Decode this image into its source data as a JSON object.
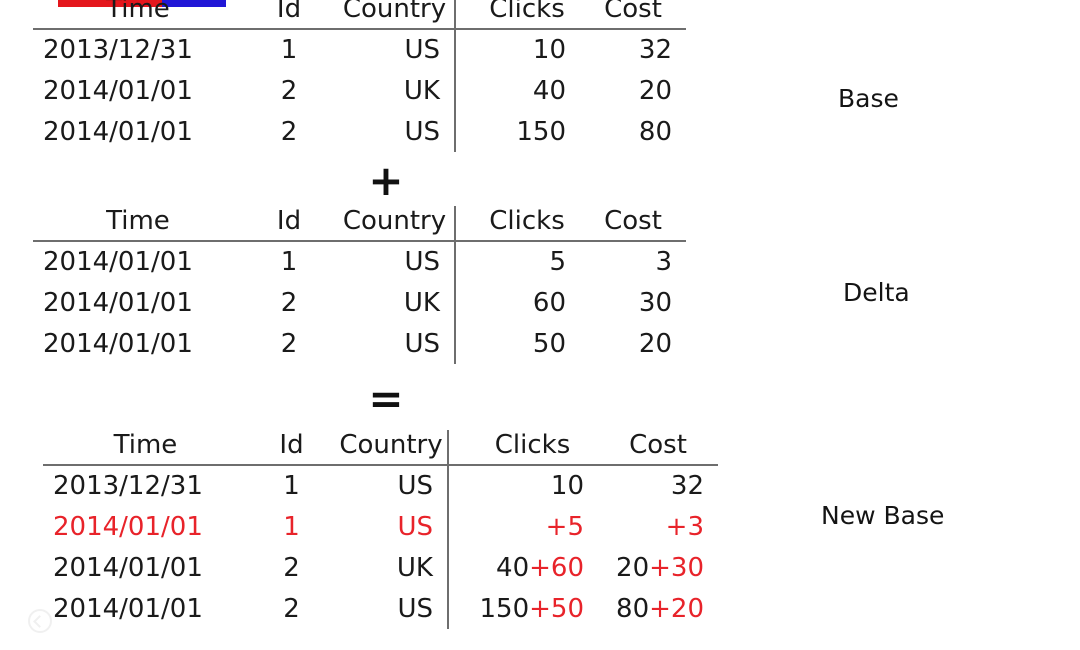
{
  "top_bar": {
    "segments": [
      {
        "name": "red-segment",
        "color": "#e4161c",
        "width_pct": 62
      },
      {
        "name": "blue-segment",
        "color": "#2117d6",
        "width_pct": 38
      }
    ]
  },
  "columns": [
    "Time",
    "Id",
    "Country",
    "Clicks",
    "Cost"
  ],
  "operators": {
    "plus": "+",
    "equals": "="
  },
  "captions": {
    "base": "Base",
    "delta": "Delta",
    "new_base": "New Base"
  },
  "colors": {
    "delta_red": "#e8232a",
    "text": "#1a1a1a",
    "rule": "#6e6e6e",
    "bar_red": "#e4161c",
    "bar_blue": "#2117d6"
  },
  "tables": {
    "base": {
      "caption": "Base",
      "headers": [
        "Time",
        "Id",
        "Country",
        "Clicks",
        "Cost"
      ],
      "rows": [
        {
          "time": "2013/12/31",
          "id": "1",
          "country": "US",
          "clicks": "10",
          "cost": "32"
        },
        {
          "time": "2014/01/01",
          "id": "2",
          "country": "UK",
          "clicks": "40",
          "cost": "20"
        },
        {
          "time": "2014/01/01",
          "id": "2",
          "country": "US",
          "clicks": "150",
          "cost": "80"
        }
      ]
    },
    "delta": {
      "caption": "Delta",
      "headers": [
        "Time",
        "Id",
        "Country",
        "Clicks",
        "Cost"
      ],
      "rows": [
        {
          "time": "2014/01/01",
          "id": "1",
          "country": "US",
          "clicks": "5",
          "cost": "3"
        },
        {
          "time": "2014/01/01",
          "id": "2",
          "country": "UK",
          "clicks": "60",
          "cost": "30"
        },
        {
          "time": "2014/01/01",
          "id": "2",
          "country": "US",
          "clicks": "50",
          "cost": "20"
        }
      ]
    },
    "new_base": {
      "caption": "New Base",
      "headers": [
        "Time",
        "Id",
        "Country",
        "Clicks",
        "Cost"
      ],
      "rows": [
        {
          "time": "2013/12/31",
          "id": "1",
          "country": "US",
          "clicks_base": "10",
          "clicks_delta": "",
          "cost_base": "32",
          "cost_delta": "",
          "is_new_row": false
        },
        {
          "time": "2014/01/01",
          "id": "1",
          "country": "US",
          "clicks_base": "",
          "clicks_delta": "+5",
          "cost_base": "",
          "cost_delta": "+3",
          "is_new_row": true
        },
        {
          "time": "2014/01/01",
          "id": "2",
          "country": "UK",
          "clicks_base": "40",
          "clicks_delta": "+60",
          "cost_base": "20",
          "cost_delta": "+30",
          "is_new_row": false
        },
        {
          "time": "2014/01/01",
          "id": "2",
          "country": "US",
          "clicks_base": "150",
          "clicks_delta": "+50",
          "cost_base": "80",
          "cost_delta": "+20",
          "is_new_row": false
        }
      ]
    }
  },
  "watermark": {
    "text": "",
    "icon": "circle-check-icon"
  }
}
